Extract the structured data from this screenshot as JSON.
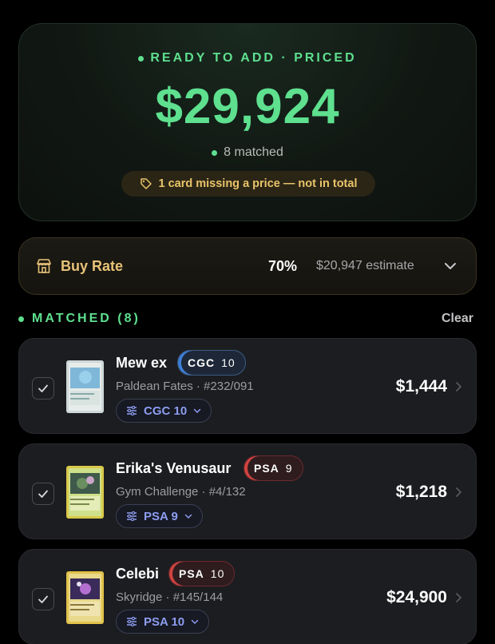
{
  "summary": {
    "status": "READY TO ADD · PRICED",
    "total": "$29,924",
    "matched": "8 matched",
    "warning": "1 card missing a price — not in total",
    "accent": "#5ee08f"
  },
  "buy_rate": {
    "label": "Buy Rate",
    "percent": "70%",
    "estimate": "$20,947 estimate",
    "icon": "storefront-icon"
  },
  "matched_section": {
    "title": "MATCHED (8)",
    "clear_label": "Clear"
  },
  "cards": [
    {
      "name": "Mew ex",
      "badge_company": "CGC",
      "badge_grade": "10",
      "set_line": "Paldean Fates · #232/091",
      "grade_selector": "CGC 10",
      "price": "$1,444",
      "checked": true
    },
    {
      "name": "Erika's Venusaur",
      "badge_company": "PSA",
      "badge_grade": "9",
      "set_line": "Gym Challenge · #4/132",
      "grade_selector": "PSA 9",
      "price": "$1,218",
      "checked": true
    },
    {
      "name": "Celebi",
      "badge_company": "PSA",
      "badge_grade": "10",
      "set_line": "Skyridge · #145/144",
      "grade_selector": "PSA 10",
      "price": "$24,900",
      "checked": true
    }
  ]
}
